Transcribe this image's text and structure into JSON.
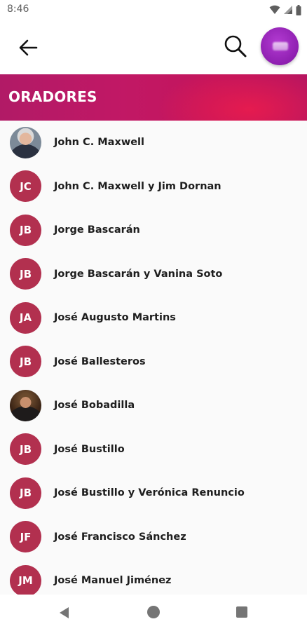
{
  "status_bar": {
    "time": "8:46"
  },
  "section": {
    "title": "ORADORES"
  },
  "speakers": [
    {
      "name": "John C. Maxwell",
      "initials": "",
      "photo": true
    },
    {
      "name": "John C. Maxwell y Jim Dornan",
      "initials": "JC"
    },
    {
      "name": "Jorge Bascarán",
      "initials": "JB"
    },
    {
      "name": "Jorge Bascarán y Vanina Soto",
      "initials": "JB"
    },
    {
      "name": "José Augusto Martins",
      "initials": "JA"
    },
    {
      "name": "José Ballesteros",
      "initials": "JB"
    },
    {
      "name": "José Bobadilla",
      "initials": "",
      "photo": true
    },
    {
      "name": "José Bustillo",
      "initials": "JB"
    },
    {
      "name": "José Bustillo y Verónica Renuncio",
      "initials": "JB"
    },
    {
      "name": "José Francisco Sánchez",
      "initials": "JF"
    },
    {
      "name": "José Manuel Jiménez",
      "initials": "JM"
    }
  ],
  "colors": {
    "avatar_bg": "#b2304f",
    "banner_start": "#b11a66",
    "banner_glow": "#e51b4f",
    "profile_button": "#8e1fb0"
  },
  "icons": {
    "back": "arrow-left-icon",
    "search": "search-icon",
    "nav_back": "triangle-back-icon",
    "nav_home": "circle-home-icon",
    "nav_recents": "square-recents-icon"
  }
}
